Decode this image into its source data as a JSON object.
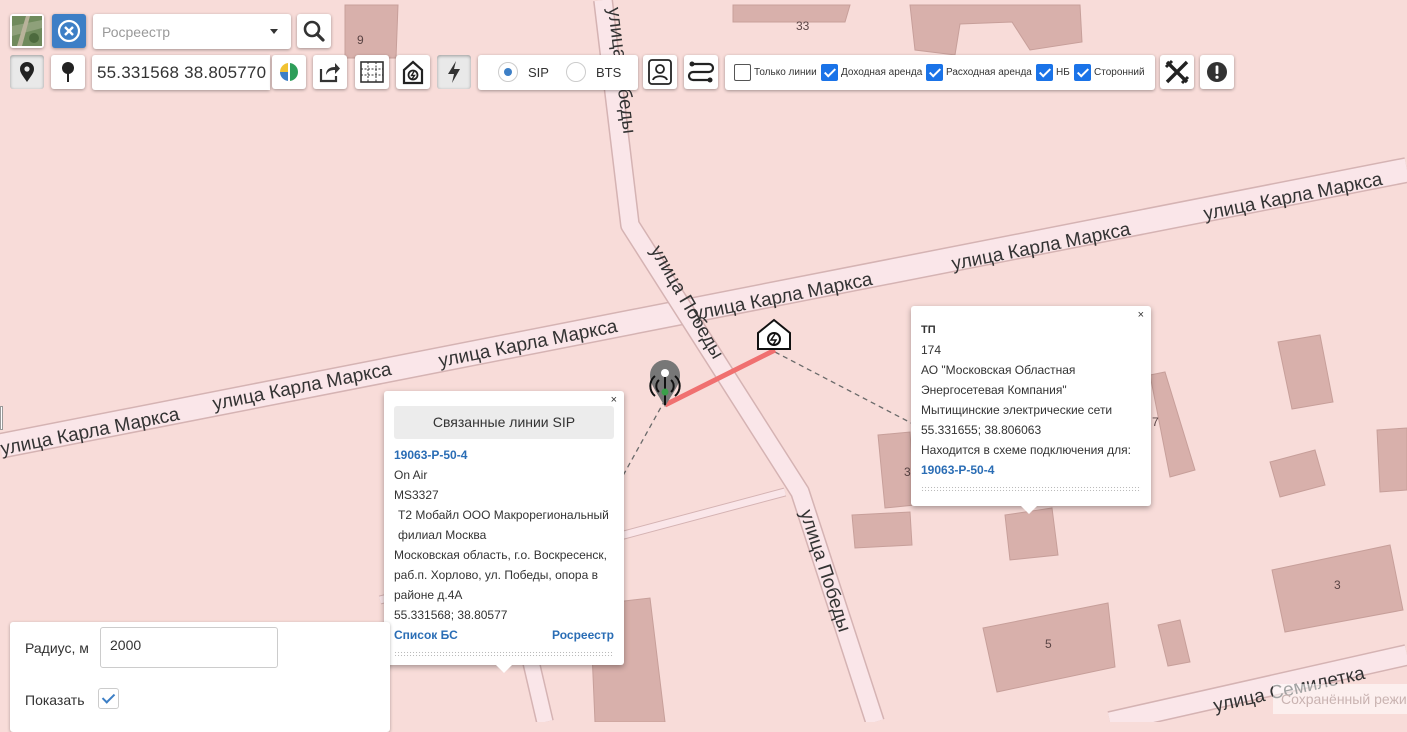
{
  "toolbar": {
    "search_placeholder": "Росреестр",
    "coordinates": "55.331568 38.805770",
    "radio": {
      "sip_label": "SIP",
      "bts_label": "BTS",
      "selected": "SIP"
    },
    "checkboxes": [
      {
        "label": "Только линии",
        "checked": false
      },
      {
        "label": "Доходная аренда",
        "checked": true
      },
      {
        "label": "Расходная аренда",
        "checked": true
      },
      {
        "label": "НБ",
        "checked": true
      },
      {
        "label": "Сторонний",
        "checked": true
      }
    ]
  },
  "map": {
    "streets": {
      "karla_marksa": "улица Карла Маркса",
      "pobedy": "улица Победы",
      "semiletka": "улица Семилетка"
    },
    "house_numbers": [
      "9",
      "33",
      "3",
      "5",
      "3",
      "7"
    ]
  },
  "popup_bs": {
    "close": "×",
    "button": "Связанные линии SIP",
    "id": "19063-Р-50-4",
    "status": "On Air",
    "code": "MS3327",
    "operator": "Т2 Мобайл ООО Макрорегиональный филиал Москва",
    "address": "Московская область, г.о. Воскресенск, раб.п. Хорлово, ул. Победы, опора в районе д.4А",
    "coords": "55.331568; 38.80577",
    "link_list": "Список БС",
    "link_registry": "Росреестр"
  },
  "popup_tp": {
    "close": "×",
    "type": "ТП",
    "number": "174",
    "org_line1": "АО \"Московская Областная",
    "org_line2": "Энергосетевая Компания\"",
    "network": "Мытищинские электрические сети",
    "coords": "55.331655; 38.806063",
    "scheme_label": "Находится в схеме подключения для:",
    "scheme_link": "19063-Р-50-4"
  },
  "radius_panel": {
    "radius_label": "Радиус, м",
    "radius_value": "2000",
    "show_label": "Показать",
    "show_checked": true
  },
  "saved_mode": "Сохранённый режим",
  "colors": {
    "map_bg": "#f8dcd9",
    "road_fill": "#fae6e9",
    "road_edge": "#d5b3b3",
    "building": "#d8b0ab",
    "link_line": "#f07070",
    "accent": "#3d7fc6"
  }
}
